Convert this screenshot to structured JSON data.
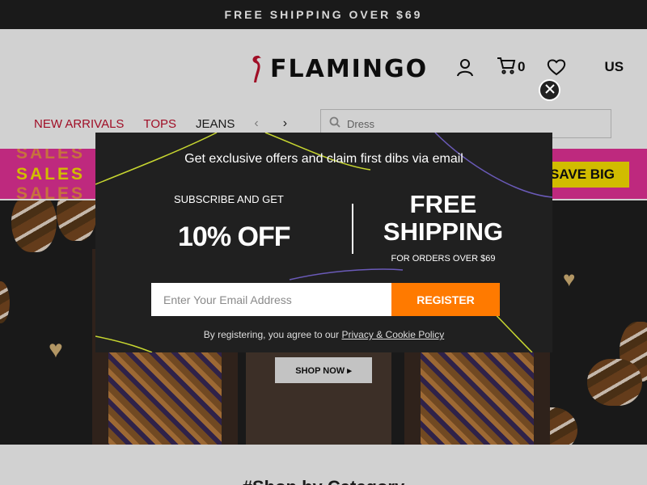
{
  "topbar": {
    "text": "FREE SHIPPING OVER $69"
  },
  "header": {
    "logo_text": "FLAMINGO",
    "cart_count": "0",
    "region": "US"
  },
  "nav": {
    "items": [
      "NEW ARRIVALS",
      "TOPS",
      "JEANS"
    ]
  },
  "search": {
    "placeholder": "Dress"
  },
  "promo": {
    "sales_text": "SALES",
    "save_text": "SAVE BIG"
  },
  "hero": {
    "shop_now": "SHOP NOW ▸"
  },
  "section": {
    "title": "#Shop by Category"
  },
  "modal": {
    "headline": "Get exclusive offers and claim first dibs via email",
    "left_sub": "SUBSCRIBE AND GET",
    "left_big": "10% OFF",
    "right_big": "FREE SHIPPING",
    "right_sub": "FOR ORDERS OVER $69",
    "email_placeholder": "Enter Your Email Address",
    "register_label": "REGISTER",
    "terms_prefix": "By registering, you agree to our ",
    "terms_link": "Privacy & Cookie Policy"
  },
  "colors": {
    "brand_red": "#c4122f",
    "accent_orange": "#ff7a00",
    "promo_pink": "#e8329a",
    "promo_yellow": "#ffe600",
    "modal_bg": "#202020"
  },
  "icons": [
    "flamingo-logo-icon",
    "user-icon",
    "cart-icon",
    "heart-icon",
    "search-icon",
    "chevron-left-icon",
    "chevron-right-icon",
    "close-icon"
  ]
}
